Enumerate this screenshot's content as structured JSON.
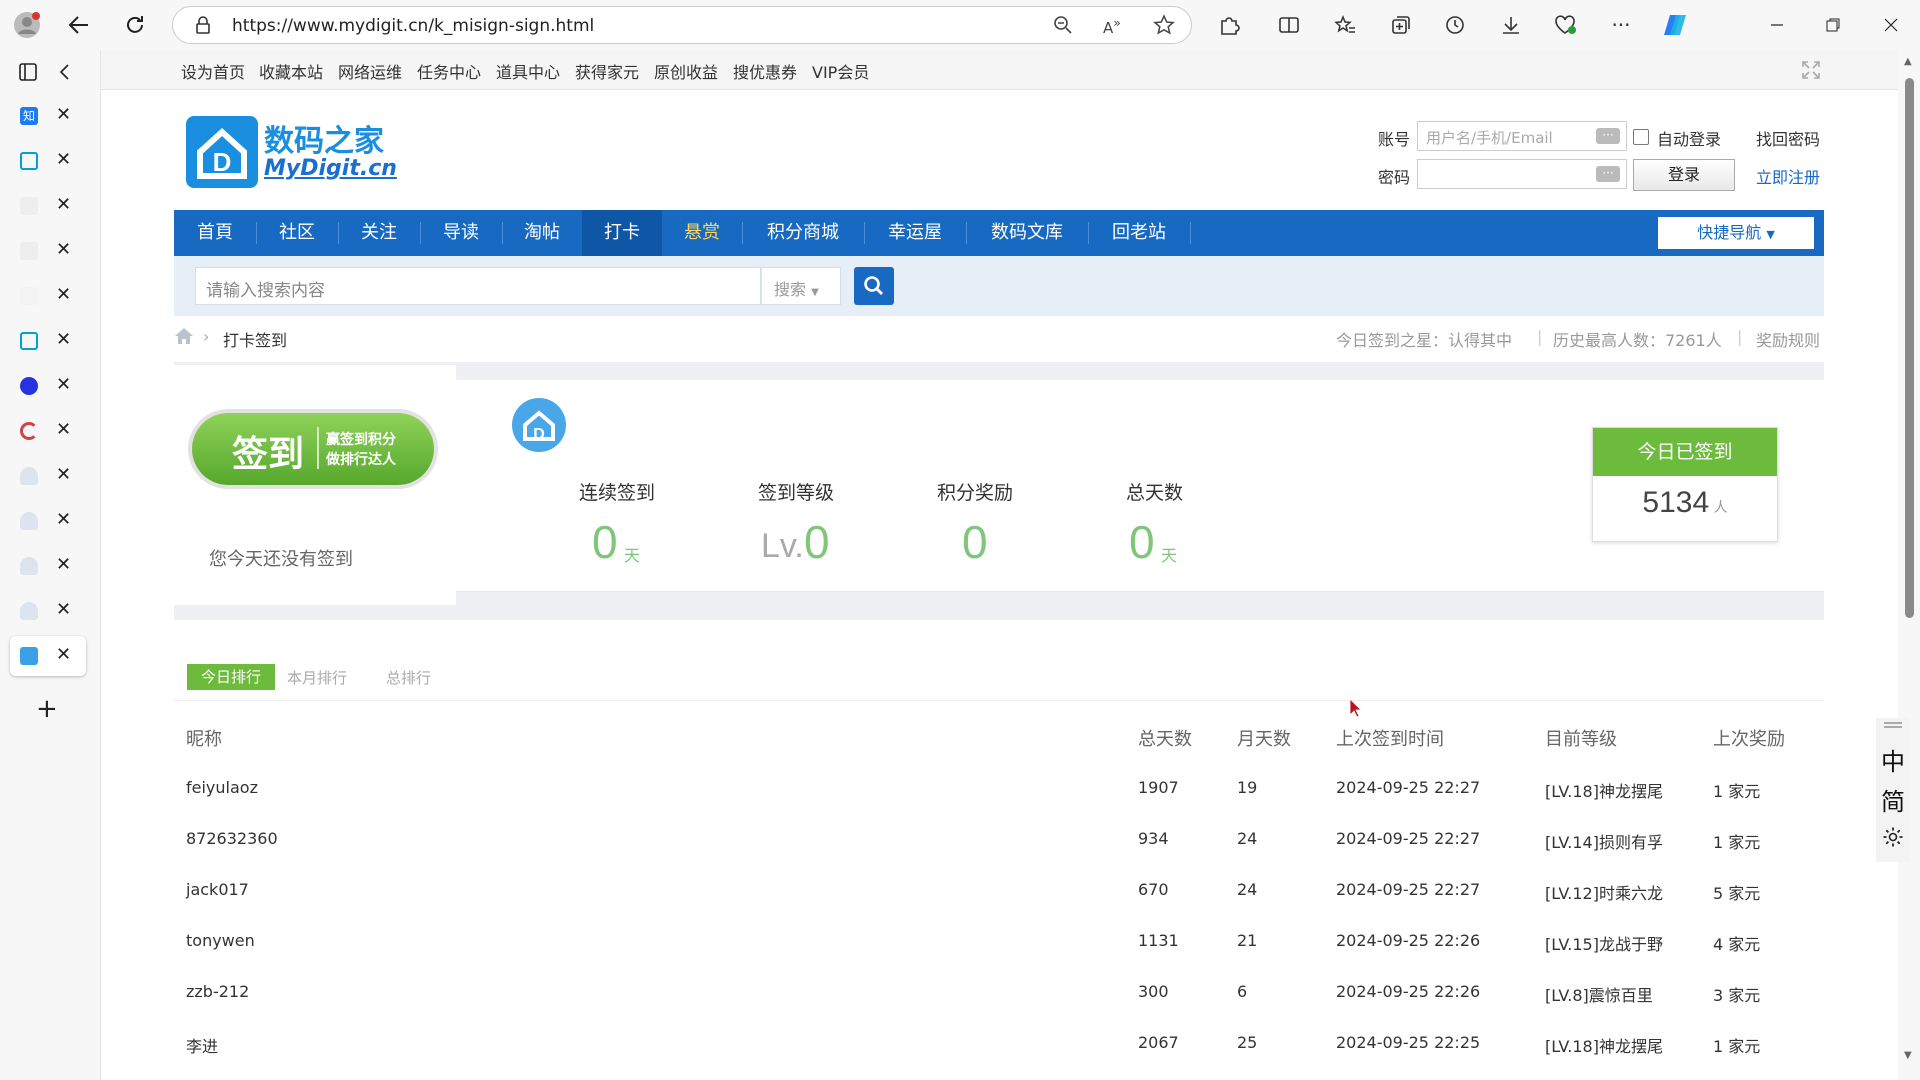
{
  "browser": {
    "url": "https://www.mydigit.cn/k_misign-sign.html"
  },
  "toplinks": [
    "设为首页",
    "收藏本站",
    "网络运维",
    "任务中心",
    "道具中心",
    "获得家元",
    "原创收益",
    "搜优惠券",
    "VIP会员"
  ],
  "logo": {
    "cn": "数码之家",
    "en": "MyDigit.cn"
  },
  "login": {
    "account_label": "账号",
    "account_placeholder": "用户名/手机/Email",
    "password_label": "密码",
    "auto_login": "自动登录",
    "find_password": "找回密码",
    "login_button": "登录",
    "register": "立即注册"
  },
  "nav": {
    "items": [
      "首頁",
      "社区",
      "关注",
      "导读",
      "淘帖",
      "打卡",
      "悬赏",
      "积分商城",
      "幸运屋",
      "数码文库",
      "回老站"
    ],
    "active": "打卡",
    "quick_nav": "快捷导航"
  },
  "search": {
    "placeholder": "请输入搜索内容",
    "type_label": "搜索"
  },
  "breadcrumb": {
    "current": "打卡签到"
  },
  "info": {
    "today_star": "今日签到之星：认得其中",
    "history_max": "历史最高人数：7261人",
    "rules": "奖励规则"
  },
  "sign": {
    "button_main": "签到",
    "button_sub1": "赢签到积分",
    "button_sub2": "做排行达人",
    "status_text": "您今天还没有签到"
  },
  "stats": [
    {
      "label": "连续签到",
      "value": "0",
      "unit": "天"
    },
    {
      "label": "签到等级",
      "prefix": "Lv.",
      "value": "0"
    },
    {
      "label": "积分奖励",
      "value": "0"
    },
    {
      "label": "总天数",
      "value": "0",
      "unit": "天"
    }
  ],
  "today_signed": {
    "label": "今日已签到",
    "count": "5134",
    "unit": "人"
  },
  "ranking": {
    "tabs": [
      "今日排行",
      "本月排行",
      "总排行"
    ],
    "active_tab": "今日排行",
    "headers": [
      "昵称",
      "总天数",
      "月天数",
      "上次签到时间",
      "目前等级",
      "上次奖励"
    ],
    "rows": [
      [
        "feiyulaoz",
        "1907",
        "19",
        "2024-09-25 22:27",
        "[LV.18]神龙摆尾",
        "1 家元"
      ],
      [
        "872632360",
        "934",
        "24",
        "2024-09-25 22:27",
        "[LV.14]损则有孚",
        "1 家元"
      ],
      [
        "jack017",
        "670",
        "24",
        "2024-09-25 22:27",
        "[LV.12]时乘六龙",
        "5 家元"
      ],
      [
        "tonywen",
        "1131",
        "21",
        "2024-09-25 22:26",
        "[LV.15]龙战于野",
        "4 家元"
      ],
      [
        "zzb-212",
        "300",
        "6",
        "2024-09-25 22:26",
        "[LV.8]震惊百里",
        "3 家元"
      ],
      [
        "李进",
        "2067",
        "25",
        "2024-09-25 22:25",
        "[LV.18]神龙摆尾",
        "1 家元"
      ]
    ]
  },
  "floatbar": {
    "lang1": "中",
    "lang2": "简"
  },
  "colors": {
    "nav_blue": "#1769c2",
    "green": "#7fc57a",
    "sign_green": "#6cbb3c",
    "yellow_active": "#ffd75a"
  }
}
